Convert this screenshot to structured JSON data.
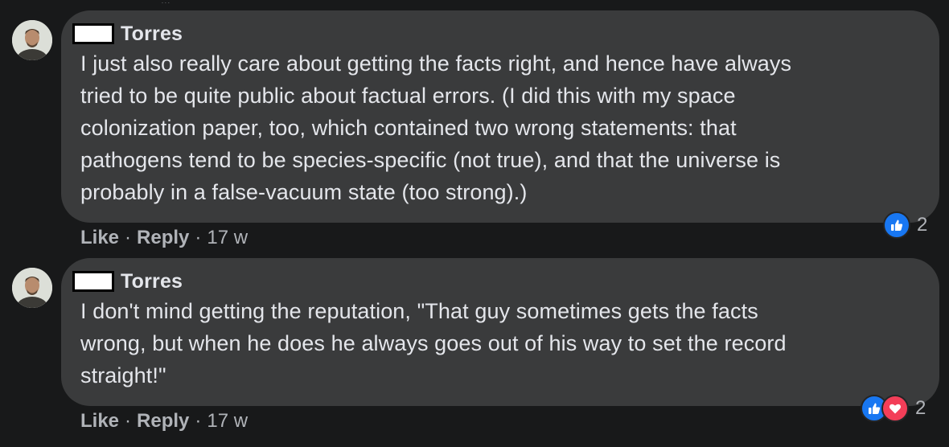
{
  "top_fragment": "...",
  "comments": [
    {
      "author": "Torres",
      "text_lines": [
        "I just also really care about getting the facts right, and hence have always",
        "tried to be quite public about factual errors. (I did this with my space",
        "colonization paper, too, which contained two wrong statements: that",
        "pathogens tend to be species-specific (not true), and that the universe is",
        "probably in a false-vacuum state (too strong).)"
      ],
      "reaction_icons": [
        "like-reaction-icon"
      ],
      "reaction_count": "2",
      "like_label": "Like",
      "reply_label": "Reply",
      "separator": "·",
      "timestamp": "17 w"
    },
    {
      "author": "Torres",
      "text_lines": [
        "I don't mind getting the reputation, \"That guy sometimes gets the facts",
        "wrong, but when he does he always goes out of his way to set the record",
        "straight!\""
      ],
      "reaction_icons": [
        "like-reaction-icon",
        "love-reaction-icon"
      ],
      "reaction_count": "2",
      "like_label": "Like",
      "reply_label": "Reply",
      "separator": "·",
      "timestamp": "17 w"
    }
  ],
  "colors": {
    "background": "#18191a",
    "bubble": "#3a3b3c",
    "text": "#e4e6eb",
    "muted": "#b0b3b8",
    "like_blue": "#1877f2",
    "love_red": "#f33e58"
  }
}
